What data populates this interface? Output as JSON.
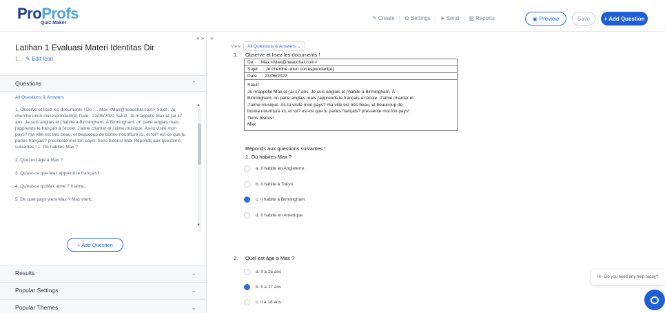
{
  "header": {
    "logo_pro": "Pro",
    "logo_profs": "Profs",
    "logo_sub": "Quiz Maker",
    "nav": [
      {
        "label": "Create",
        "icon": "pencil-icon"
      },
      {
        "label": "Settings",
        "icon": "gear-icon"
      },
      {
        "label": "Send",
        "icon": "send-icon"
      },
      {
        "label": "Reports",
        "icon": "chart-icon"
      }
    ],
    "preview_label": "Preview",
    "save_label": "Save",
    "add_question_label": "+ Add Question"
  },
  "left": {
    "quiz_title": "Latihan 1 Evaluasi Materi Identitas Dir",
    "quiz_meta_prefix": "1...",
    "edit_icon_label": "Edit Icon",
    "sections": {
      "questions": "Questions",
      "results": "Results",
      "popular_settings": "Popular Settings",
      "popular_themes": "Popular Themes"
    },
    "filter_label": "All Questions & Answers",
    "questions": [
      "1. Observe et lisez les documents ! De : ...Max <Max@neauchat.com> Sujet : Je cherche unun correspondant(e) Date : 23/06/2022 Salut!, Je m'appelle Max et j'ai 17 ans. Je suis anglais et j'habite à Birmingham. À Birmingham, on parle anglais mais j'apprends le français à l'école. J'aime chanter et j'aime musique. As-tu visité mon pays? ma ville est très beau, et beaucoup de bonne nourriture ici, et toi? est-ce que tu parles français? pressente moi ton pays! Tiens bisous! Max Réponds aux questions suivantes ! 1. Où habites Max ?",
      "2. Quel est âge a Max ?",
      "3. Qu'est-ce que Max apprend le français?",
      "4. Qu'est-ce qu'Max aime ? Il aime...",
      "5. De quel pays vient Max ? Max vient..."
    ],
    "add_question_label": "+ Add Question"
  },
  "editor": {
    "view_label": "View",
    "view_value": "All Questions & Answers",
    "q1_number": "1.",
    "q1_text": "Observe et lisez les documents !",
    "mail_de_label": "De",
    "mail_de_value": ": Max <Max@neauchat.com>",
    "mail_sujet_label": "Sujet",
    "mail_sujet_value": ": Je cherche unun correspondant(e)",
    "mail_date_label": "Date",
    "mail_date_value": ": 23/06/2022",
    "mail_body": [
      "Salut!",
      "Je m'appelle Max et j'ai 17 ans. Je suis anglais et j'habite à Birmingham. À",
      "Birmingham, on parle anglais mais j'apprends le français à l'école. J'aime chanter et",
      "J'aime musique. As-tu visité mon pays? ma ville est très beau, et beaucoup de",
      "bonne nourriture ici, et toi? est-ce que tu parles français? pressente moi ton pays!",
      "Tiens bisous!",
      "Max"
    ],
    "q1_subheading": "Réponds aux questions suivantes !",
    "q1_sub": "1. Où habites Max ?",
    "q1_options": [
      {
        "label": "a. Il habite en Angleterre",
        "checked": false
      },
      {
        "label": "b. Il habite à Tokyo",
        "checked": false
      },
      {
        "label": "c. Il habite à Birmingham",
        "checked": true
      },
      {
        "label": "d. Il habite en Amérique",
        "checked": false
      }
    ],
    "q2_number": "2.",
    "q2_text": "Quel est âge a Max ?",
    "q2_options": [
      {
        "label": "a. Il a 15 ans",
        "checked": false
      },
      {
        "label": "b. Il a 17 ans",
        "checked": true
      },
      {
        "label": "c. Il a 18 ans",
        "checked": false
      }
    ]
  },
  "chat": {
    "bubble_text": "Hi - Do you need any help today?"
  }
}
